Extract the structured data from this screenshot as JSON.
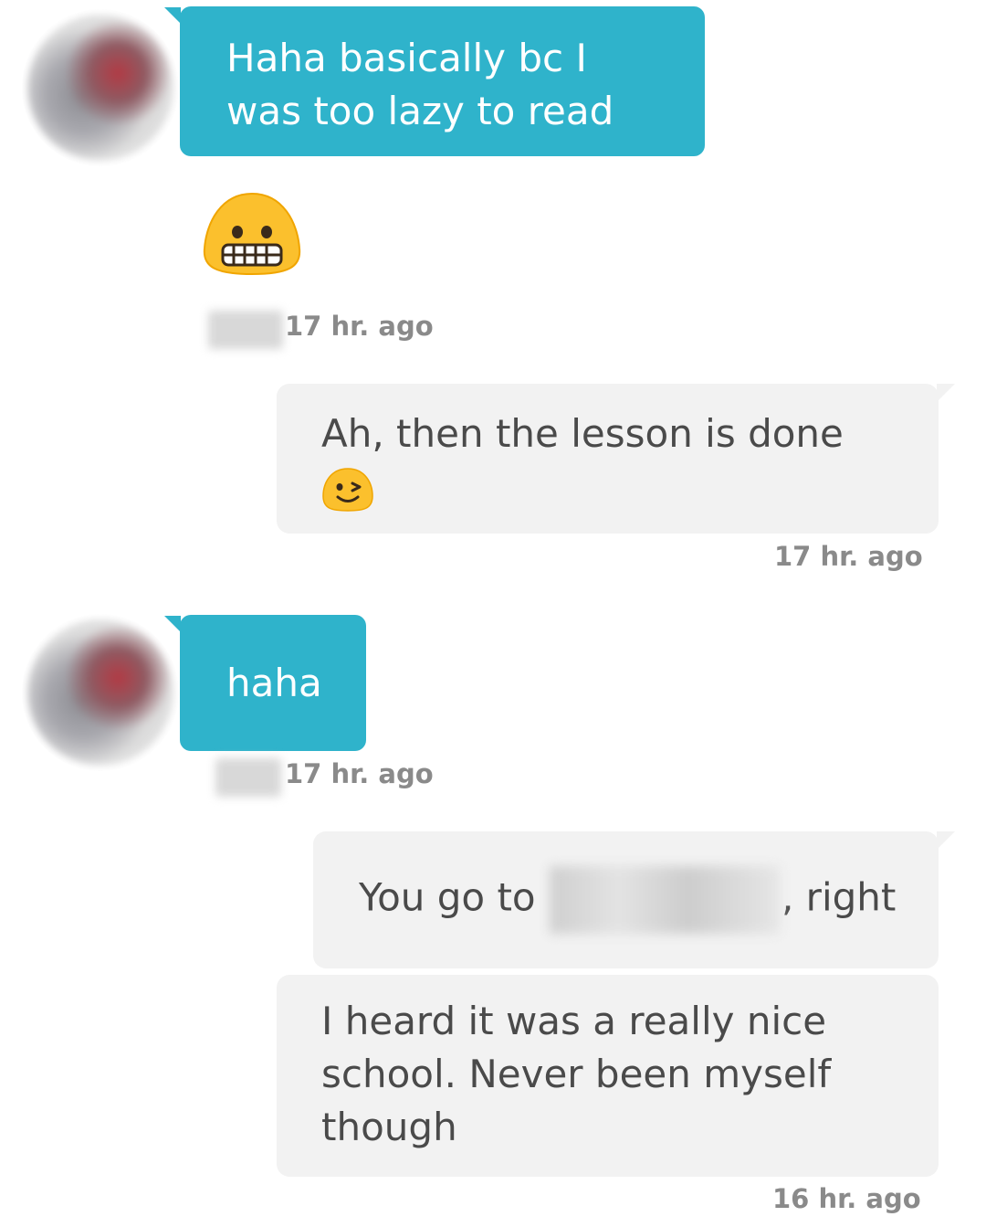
{
  "messages": [
    {
      "id": "m1",
      "direction": "incoming",
      "text": "Haha basically bc I was too lazy to read"
    },
    {
      "id": "m2",
      "direction": "incoming",
      "emoji": "grimacing-face"
    },
    {
      "id": "m2_time",
      "timestamp": "17 hr. ago"
    },
    {
      "id": "m3",
      "direction": "outgoing",
      "text": "Ah, then the lesson is done",
      "emoji": "winking-face",
      "timestamp": "17 hr. ago"
    },
    {
      "id": "m4",
      "direction": "incoming",
      "text": "haha",
      "timestamp": "17 hr. ago"
    },
    {
      "id": "m5",
      "direction": "outgoing",
      "text_before": "You go to",
      "text_after": ", right"
    },
    {
      "id": "m6",
      "direction": "outgoing",
      "text": "I heard it was a really nice school. Never been myself though",
      "timestamp": "16 hr. ago"
    }
  ],
  "colors": {
    "incoming_bubble": "#2fb3cb",
    "outgoing_bubble": "#f2f2f2",
    "outgoing_text": "#4a4a4a",
    "timestamp": "#8a8a8a"
  }
}
